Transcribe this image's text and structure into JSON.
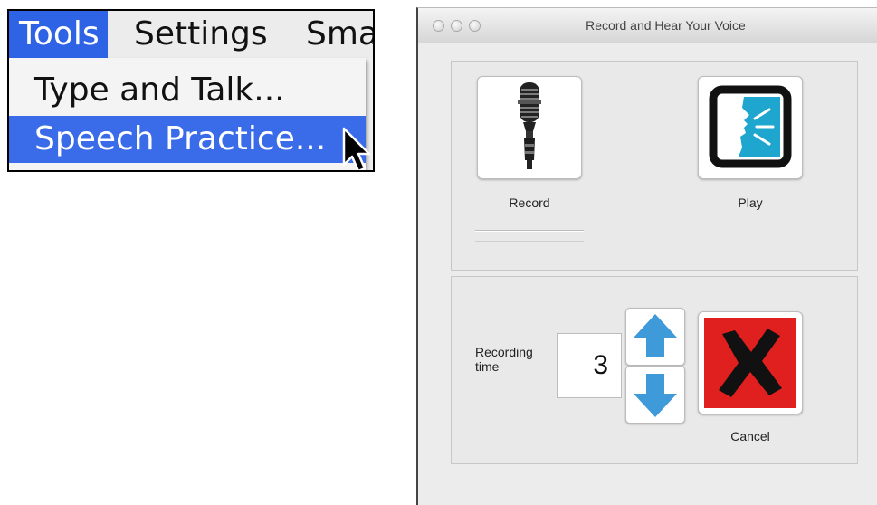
{
  "menu": {
    "bar_items": [
      "Tools",
      "Settings",
      "Sma"
    ],
    "dropdown_items": [
      "Type and Talk...",
      "Speech Practice..."
    ]
  },
  "window": {
    "title": "Record and Hear Your Voice"
  },
  "buttons": {
    "record_label": "Record",
    "play_label": "Play",
    "cancel_label": "Cancel"
  },
  "recording": {
    "label": "Recording time",
    "value": "3"
  },
  "icons": [
    "microphone-icon",
    "play-speech-icon",
    "arrow-up-icon",
    "arrow-down-icon",
    "cancel-x-icon"
  ],
  "colors": {
    "menu_highlight": "#3a6be8",
    "arrow_blue": "#3f9ad9",
    "cancel_red": "#e0201f",
    "play_cyan": "#1fa6cf"
  }
}
